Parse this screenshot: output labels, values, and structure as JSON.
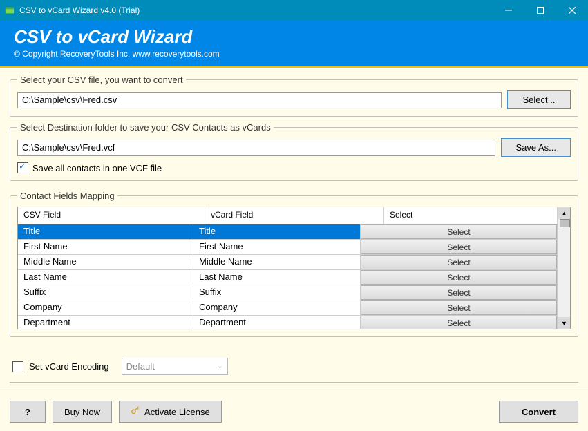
{
  "window": {
    "title": "CSV to vCard Wizard v4.0 (Trial)"
  },
  "header": {
    "title": "CSV to vCard Wizard",
    "copyright": "© Copyright RecoveryTools Inc. www.recoverytools.com"
  },
  "source": {
    "legend": "Select your CSV file, you want to convert",
    "path": "C:\\Sample\\csv\\Fred.csv",
    "button": "Select..."
  },
  "dest": {
    "legend": "Select Destination folder to save your CSV Contacts as vCards",
    "path": "C:\\Sample\\csv\\Fred.vcf",
    "button": "Save As...",
    "checkbox_label": "Save all contacts in one VCF file",
    "checkbox_checked": true
  },
  "mapping": {
    "legend": "Contact Fields Mapping",
    "headers": {
      "csv": "CSV Field",
      "vcard": "vCard Field",
      "select": "Select"
    },
    "select_label": "Select",
    "rows": [
      {
        "csv": "Title",
        "vcard": "Title"
      },
      {
        "csv": "First Name",
        "vcard": "First Name"
      },
      {
        "csv": "Middle Name",
        "vcard": "Middle Name"
      },
      {
        "csv": "Last Name",
        "vcard": "Last Name"
      },
      {
        "csv": "Suffix",
        "vcard": "Suffix"
      },
      {
        "csv": "Company",
        "vcard": "Company"
      },
      {
        "csv": "Department",
        "vcard": "Department"
      }
    ]
  },
  "encoding": {
    "label": "Set vCard Encoding",
    "value": "Default",
    "checked": false
  },
  "footer": {
    "help": "?",
    "buy": "Buy Now",
    "activate": "Activate License",
    "convert": "Convert"
  }
}
